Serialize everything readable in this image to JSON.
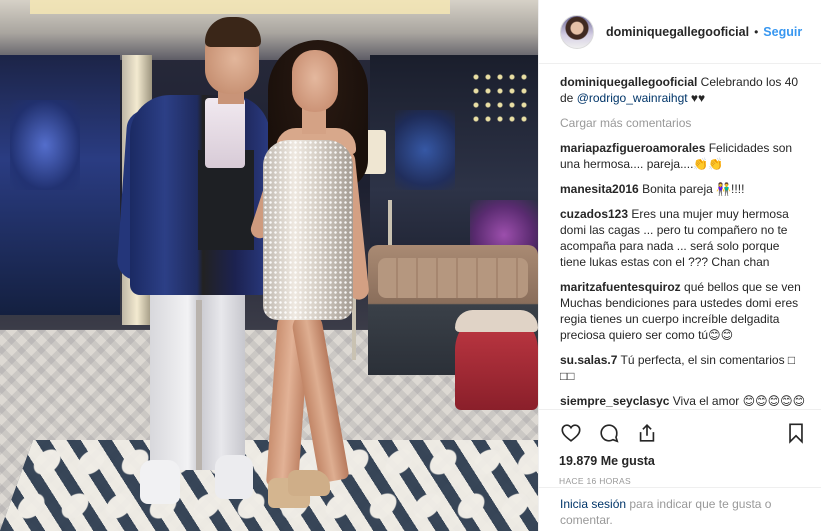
{
  "header": {
    "username": "dominiquegallegooficial",
    "separator": "•",
    "follow_label": "Seguir"
  },
  "caption": {
    "username": "dominiquegallegooficial",
    "text_before": " Celebrando los 40 de ",
    "mention": "@rodrigo_wainraihgt",
    "text_after": " ♥♥"
  },
  "load_more": "Cargar más comentarios",
  "comments": [
    {
      "user": "mariapazfigueroamorales",
      "text": " Felicidades son una hermosa.... pareja....👏👏"
    },
    {
      "user": "manesita2016",
      "text": " Bonita pareja 👫!!!!"
    },
    {
      "user": "cuzados123",
      "text": " Eres una mujer muy hermosa domi las cagas ... pero tu compañero no te acompaña para nada ... será solo porque tiene lukas estas con el ??? Chan chan"
    },
    {
      "user": "maritzafuentesquiroz",
      "text": " qué bellos que se ven Muchas bendiciones para ustedes domi eres regia tienes un cuerpo increíble delgadita preciosa quiero ser como tú😊😊"
    },
    {
      "user": "su.salas.7",
      "text": " Tú perfecta, el sin comentarios □ □□"
    },
    {
      "user": "siempre_seyclasyc",
      "text": " Viva el amor 😊😊😊😊😊"
    }
  ],
  "actions": {
    "like_icon": "heart-icon",
    "comment_icon": "comment-bubble-icon",
    "share_icon": "share-icon",
    "save_icon": "bookmark-icon"
  },
  "likes": "19.879 Me gusta",
  "timestamp": "HACE 16 HORAS",
  "login": {
    "link": "Inicia sesión",
    "text": " para indicar que te gusta o comentar."
  },
  "colors": {
    "accent": "#3897f0",
    "mention": "#003569",
    "muted": "#999999",
    "text": "#262626"
  }
}
